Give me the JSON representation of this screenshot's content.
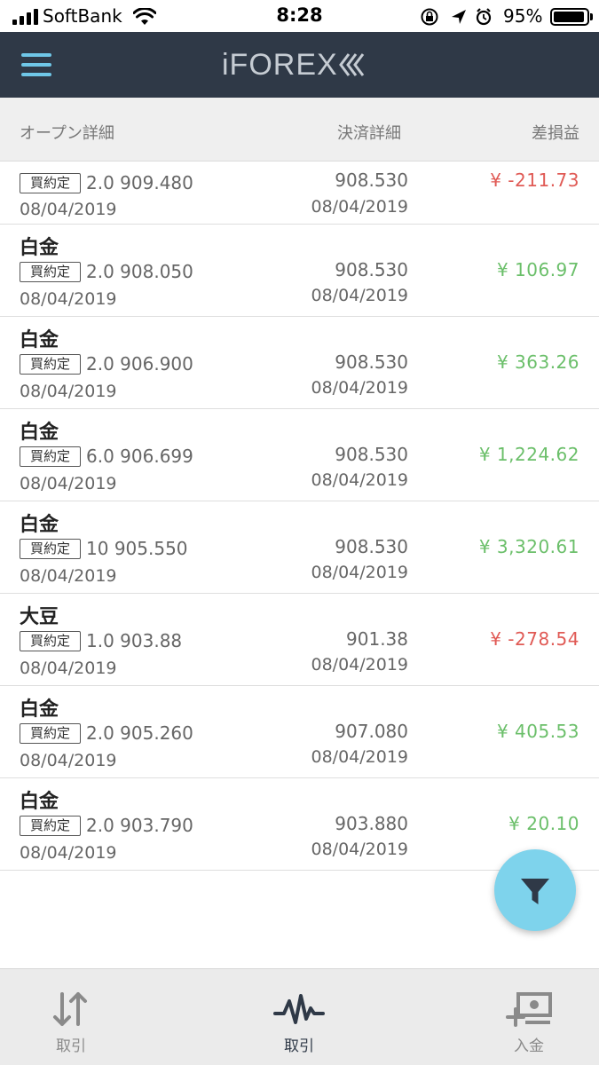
{
  "status_bar": {
    "carrier": "SoftBank",
    "time": "8:28",
    "battery_percent": "95%",
    "battery_level": 0.95,
    "icons": [
      "signal-icon",
      "wifi-icon",
      "screen-lock-icon",
      "location-icon",
      "alarm-icon",
      "battery-icon"
    ]
  },
  "header": {
    "logo_text": "iFOREX",
    "menu_icon": "hamburger-menu-icon",
    "bg_color": "#2f3947",
    "accent_color": "#6fc7e8"
  },
  "columns": {
    "open": "オープン詳細",
    "close": "決済詳細",
    "pl": "差損益"
  },
  "rows": [
    {
      "instrument": "",
      "badge": "買約定",
      "open": "2.0 909.480",
      "open_date": "08/04/2019",
      "close_price": "908.530",
      "close_date": "08/04/2019",
      "pl": "¥ -211.73",
      "pl_sign": "neg"
    },
    {
      "instrument": "白金",
      "badge": "買約定",
      "open": "2.0 908.050",
      "open_date": "08/04/2019",
      "close_price": "908.530",
      "close_date": "08/04/2019",
      "pl": "¥ 106.97",
      "pl_sign": "pos"
    },
    {
      "instrument": "白金",
      "badge": "買約定",
      "open": "2.0 906.900",
      "open_date": "08/04/2019",
      "close_price": "908.530",
      "close_date": "08/04/2019",
      "pl": "¥ 363.26",
      "pl_sign": "pos"
    },
    {
      "instrument": "白金",
      "badge": "買約定",
      "open": "6.0 906.699",
      "open_date": "08/04/2019",
      "close_price": "908.530",
      "close_date": "08/04/2019",
      "pl": "¥ 1,224.62",
      "pl_sign": "pos"
    },
    {
      "instrument": "白金",
      "badge": "買約定",
      "open": "10 905.550",
      "open_date": "08/04/2019",
      "close_price": "908.530",
      "close_date": "08/04/2019",
      "pl": "¥ 3,320.61",
      "pl_sign": "pos"
    },
    {
      "instrument": "大豆",
      "badge": "買約定",
      "open": "1.0 903.88",
      "open_date": "08/04/2019",
      "close_price": "901.38",
      "close_date": "08/04/2019",
      "pl": "¥ -278.54",
      "pl_sign": "neg"
    },
    {
      "instrument": "白金",
      "badge": "買約定",
      "open": "2.0 905.260",
      "open_date": "08/04/2019",
      "close_price": "907.080",
      "close_date": "08/04/2019",
      "pl": "¥ 405.53",
      "pl_sign": "pos"
    },
    {
      "instrument": "白金",
      "badge": "買約定",
      "open": "2.0 903.790",
      "open_date": "08/04/2019",
      "close_price": "903.880",
      "close_date": "08/04/2019",
      "pl": "¥ 20.10",
      "pl_sign": "pos"
    }
  ],
  "colors": {
    "negative": "#e05a55",
    "positive": "#6bbf6a",
    "fab": "#7ed3ec"
  },
  "fab": {
    "icon": "filter-icon"
  },
  "bottom_nav": [
    {
      "label": "取引",
      "icon": "up-down-arrows-icon",
      "active": false
    },
    {
      "label": "取引",
      "icon": "pulse-line-icon",
      "active": true
    },
    {
      "label": "入金",
      "icon": "deposit-cash-icon",
      "active": false
    }
  ]
}
